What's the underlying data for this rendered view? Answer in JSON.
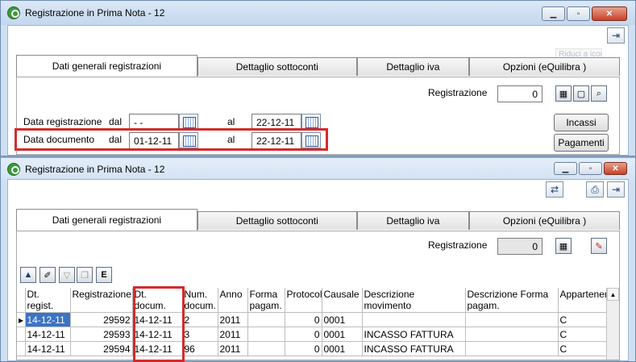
{
  "window1": {
    "title": "Registrazione in Prima Nota - 12",
    "tooltip": "Riduci a icona",
    "tabs": [
      "Dati generali registrazioni",
      "Dettaglio sottoconti",
      "Dettaglio iva",
      "Opzioni (eQuilibra )"
    ],
    "registrazione_label": "Registrazione",
    "registrazione_value": "0",
    "data_registrazione_label": "Data registrazione",
    "dal_label": "dal",
    "al_label": "al",
    "data_registrazione_dal": "- -",
    "data_registrazione_al": "22-12-11",
    "data_documento_label": "Data documento",
    "data_documento_dal": "01-12-11",
    "data_documento_al": "22-12-11",
    "incassi_label": "Incassi",
    "pagamenti_label": "Pagamenti"
  },
  "window2": {
    "title": "Registrazione in Prima Nota - 12",
    "tabs": [
      "Dati generali registrazioni",
      "Dettaglio sottoconti",
      "Dettaglio iva",
      "Opzioni (eQuilibra )"
    ],
    "registrazione_label": "Registrazione",
    "registrazione_value": "0",
    "columns": [
      "Dt. regist.",
      "Registrazione",
      "Dt. docum.",
      "Num. docum.",
      "Anno",
      "Forma pagam.",
      "Protocol",
      "Causale",
      "Descrizione movimento",
      "Descrizione Forma pagam.",
      "Appartenen"
    ],
    "rows": [
      [
        "14-12-11",
        "29592",
        "14-12-11",
        "2",
        "2011",
        "",
        "0",
        "0001",
        "",
        "",
        "C"
      ],
      [
        "14-12-11",
        "29593",
        "14-12-11",
        "3",
        "2011",
        "",
        "0",
        "0001",
        "INCASSO FATTURA",
        "",
        "C"
      ],
      [
        "14-12-11",
        "29594",
        "14-12-11",
        "96",
        "2011",
        "",
        "0",
        "0001",
        "INCASSO FATTURA",
        "",
        "C"
      ]
    ]
  },
  "colors": {
    "highlight": "#d42b2b",
    "selection": "#3b73c6",
    "frame": "#cfe0f3"
  }
}
